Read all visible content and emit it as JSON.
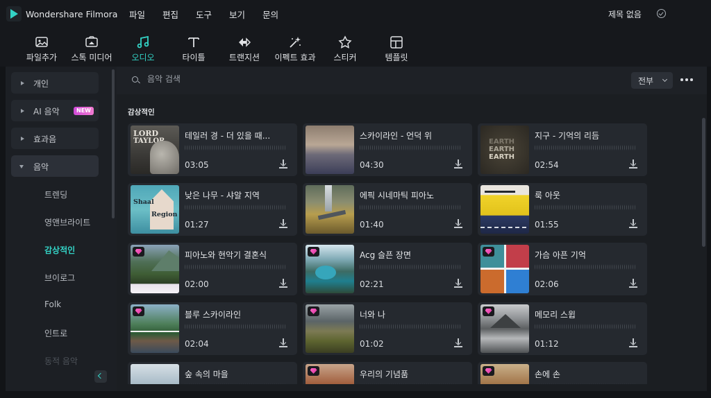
{
  "app": {
    "name": "Wondershare Filmora",
    "doc_title": "제목 없음"
  },
  "menu": [
    "파일",
    "편집",
    "도구",
    "보기",
    "문의"
  ],
  "toolbar": [
    {
      "label": "파일추가",
      "icon": "image-import-icon"
    },
    {
      "label": "스톡 미디어",
      "icon": "stock-media-icon"
    },
    {
      "label": "오디오",
      "icon": "music-note-icon",
      "active": true
    },
    {
      "label": "타이틀",
      "icon": "title-text-icon"
    },
    {
      "label": "트랜지션",
      "icon": "transition-icon"
    },
    {
      "label": "이펙트 효과",
      "icon": "effects-icon"
    },
    {
      "label": "스티커",
      "icon": "sticker-icon"
    },
    {
      "label": "템플릿",
      "icon": "template-icon"
    }
  ],
  "sidebar": {
    "sections": [
      {
        "label": "개인"
      },
      {
        "label": "AI 음악",
        "badge": "NEW"
      },
      {
        "label": "효과음"
      },
      {
        "label": "음악",
        "expanded": true
      }
    ],
    "subitems": [
      "트렌딩",
      "영앤브라이트",
      "감상적인",
      "브이로그",
      "Folk",
      "인트로",
      "동적 음악"
    ],
    "active_subitem": "감상적인"
  },
  "search": {
    "placeholder": "음악 검색"
  },
  "filter": {
    "selected": "전부"
  },
  "section_title": "감상적인",
  "tracks": [
    {
      "title": "테일러 경 - 더 있을 때...",
      "duration": "03:05",
      "premium": false
    },
    {
      "title": "스카이라인 - 언덕 위",
      "duration": "04:30",
      "premium": false
    },
    {
      "title": "지구 - 기억의 리듬",
      "duration": "02:54",
      "premium": false
    },
    {
      "title": "낮은 나무 - 샤알 지역",
      "duration": "01:27",
      "premium": false
    },
    {
      "title": "에픽 시네마틱 피아노",
      "duration": "01:40",
      "premium": false
    },
    {
      "title": "룩 아웃",
      "duration": "01:55",
      "premium": false
    },
    {
      "title": "피아노와 현악기 결혼식",
      "duration": "02:00",
      "premium": true
    },
    {
      "title": "Acg 슬픈 장면",
      "duration": "02:21",
      "premium": true
    },
    {
      "title": "가슴 아픈 기억",
      "duration": "02:06",
      "premium": true
    },
    {
      "title": "블루 스카이라인",
      "duration": "02:04",
      "premium": true
    },
    {
      "title": "너와 나",
      "duration": "01:02",
      "premium": true
    },
    {
      "title": "메모리 스윕",
      "duration": "01:12",
      "premium": true
    },
    {
      "title": "숲 속의 마을",
      "duration": "",
      "premium": false
    },
    {
      "title": "우리의 기념품",
      "duration": "",
      "premium": true
    },
    {
      "title": "손에 손",
      "duration": "",
      "premium": true
    }
  ],
  "thumb_text": {
    "t1": [
      "LORD",
      "TAYLOR"
    ],
    "t3": [
      "EARTH",
      "EARTH",
      "EARTH"
    ],
    "t4": [
      "Shaal",
      "Region"
    ]
  }
}
